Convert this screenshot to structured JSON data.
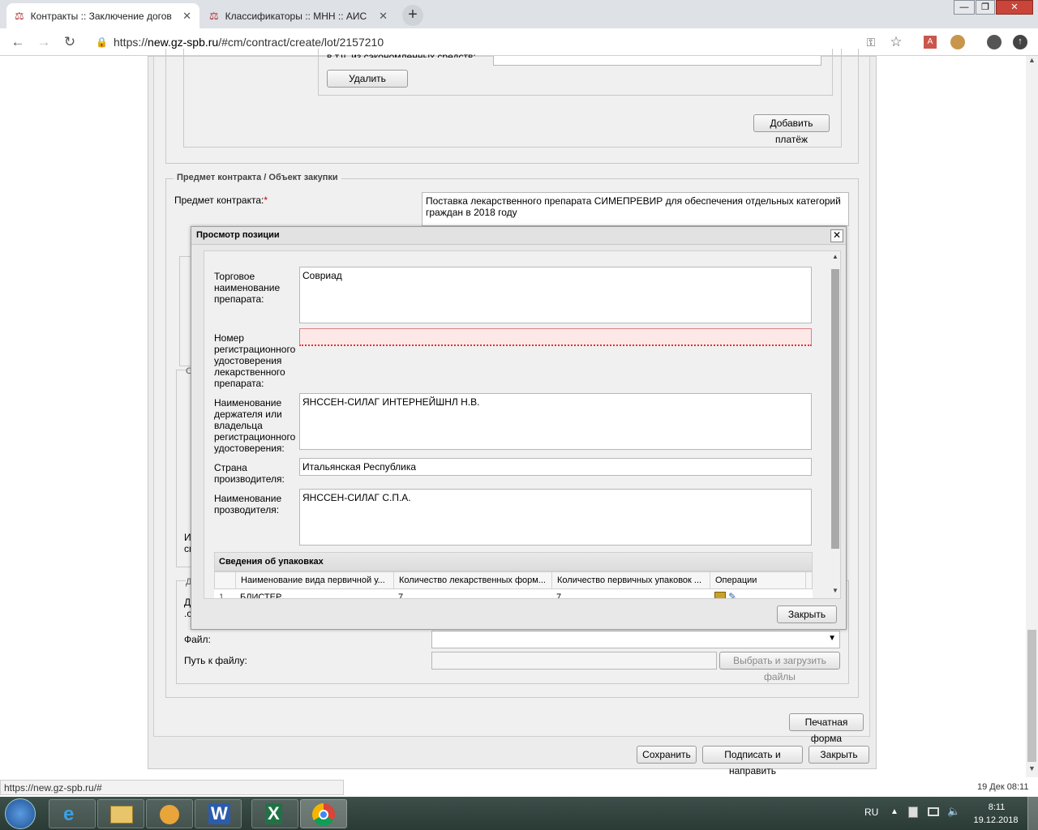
{
  "browser": {
    "tabs": [
      {
        "title": "Контракты :: Заключение догов",
        "close": "✕"
      },
      {
        "title": "Классификаторы :: МНН :: АИС",
        "close": "✕"
      }
    ],
    "new_tab": "+",
    "url_prefix": "https://",
    "url_host": "new.gz-spb.ru",
    "url_path": "/#cm/contract/create/lot/2157210",
    "window_controls": [
      "—",
      "❐",
      "✕"
    ]
  },
  "page": {
    "partial_label": "в т.ч. из сэкономленных средств:",
    "delete_button": "Удалить",
    "add_payment_button": "Добавить платёж",
    "subject_legend": "Предмет контракта / Объект закупки",
    "subject_label": "Предмет контракта:",
    "required_mark": "*",
    "subject_value": "Поставка лекарственного препарата  СИМЕПРЕВИР  для обеспечения отдельных категорий граждан в 2018 году",
    "file_label": "Файл:",
    "file_path_label": "Путь к файлу:",
    "choose_upload_button": "Выбрать и загрузить файлы",
    "print_form_button": "Печатная форма",
    "save_button": "Сохранить",
    "sign_send_button": "Подписать и направить",
    "close_button": "Закрыть",
    "obscured_fragments": [
      "С",
      "И",
      "сп",
      "Д",
      "Д",
      ".с"
    ]
  },
  "modal": {
    "title": "Просмотр позиции",
    "close_x": "✕",
    "fields": [
      {
        "label": "Торговое наименование препарата:",
        "value": ""
      },
      {
        "label": "Номер регистрационного удостоверения лекарственного препарата:",
        "value": ""
      },
      {
        "label": "Наименование держателя или владельца регистрационного удостоверения:",
        "value": "ЯНССЕН-СИЛАГ ИНТЕРНЕЙШНЛ Н.В."
      },
      {
        "label": "Страна производителя:",
        "value": "Итальянская Республика"
      },
      {
        "label": "Наименование прозводителя:",
        "value": "ЯНССЕН-СИЛАГ С.П.А."
      }
    ],
    "trade_name_value": "Совриад",
    "packaging_section": "Сведения об упаковках",
    "table_headers": [
      "Наименование вида первичной у...",
      "Количество лекарственных форм...",
      "Количество первичных упаковок ...",
      "Операции"
    ],
    "table_row": {
      "num": "1",
      "name": "БЛИСТЕР",
      "qty_forms": "7",
      "qty_packs": "7"
    },
    "close_button": "Закрыть"
  },
  "status": {
    "url": "https://new.gz-spb.ru/#",
    "datetime": "19 Дек 08:11"
  },
  "taskbar": {
    "lang": "RU",
    "time": "8:11",
    "date": "19.12.2018"
  }
}
